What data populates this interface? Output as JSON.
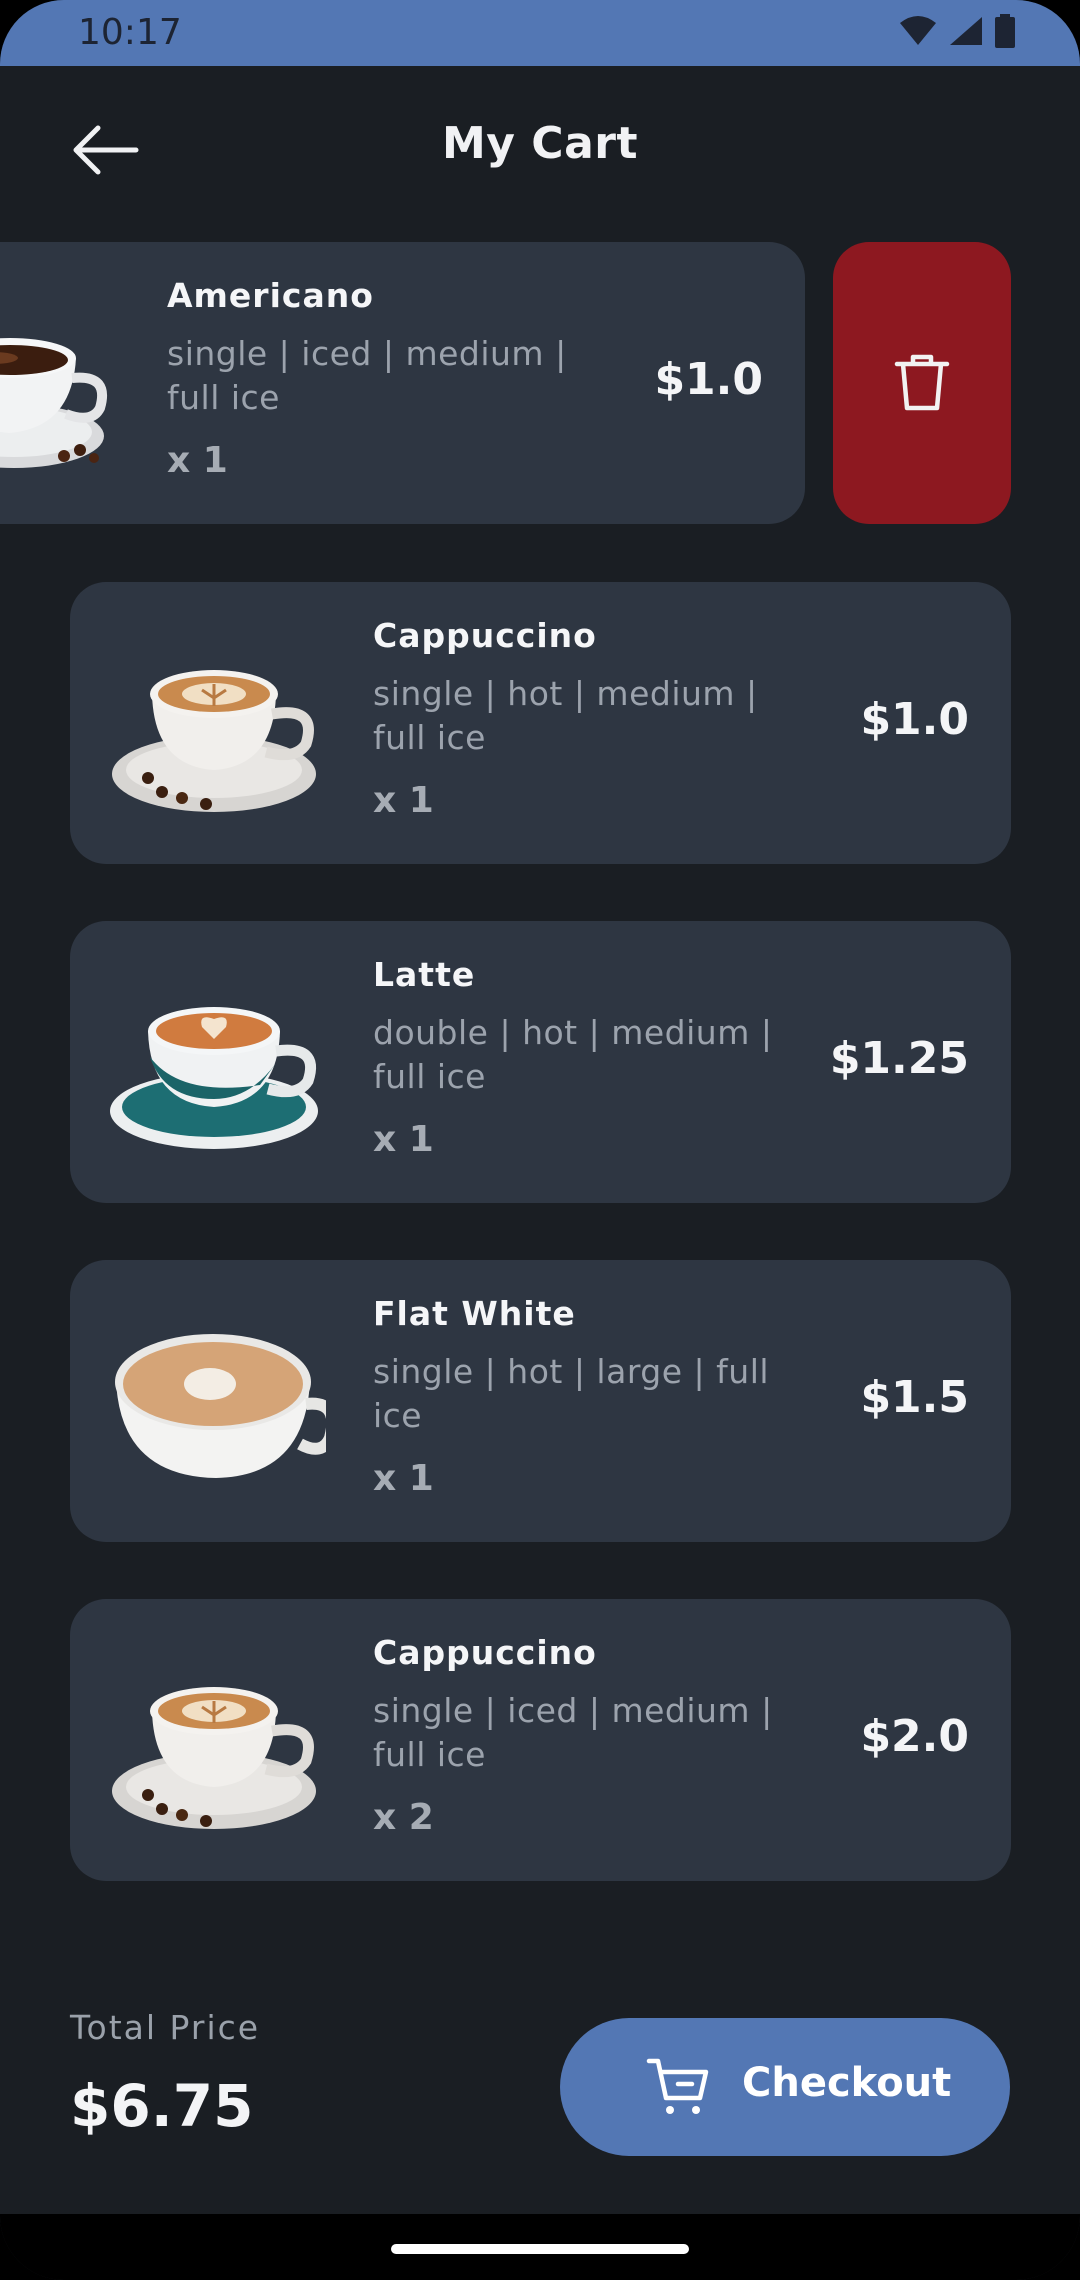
{
  "status_bar": {
    "time": "10:17"
  },
  "header": {
    "title": "My Cart"
  },
  "cart_items": [
    {
      "name": "Americano",
      "options": "single | iced | medium | full ice",
      "qty": "x 1",
      "price": "$1.0"
    },
    {
      "name": "Cappuccino",
      "options": "single | hot | medium | full ice",
      "qty": "x 1",
      "price": "$1.0"
    },
    {
      "name": "Latte",
      "options": "double | hot | medium | full ice",
      "qty": "x 1",
      "price": "$1.25"
    },
    {
      "name": "Flat White",
      "options": "single | hot | large | full ice",
      "qty": "x 1",
      "price": "$1.5"
    },
    {
      "name": "Cappuccino",
      "options": "single | iced | medium | full ice",
      "qty": "x 2",
      "price": "$2.0"
    }
  ],
  "footer": {
    "total_label": "Total Price",
    "total_value": "$6.75",
    "checkout_label": "Checkout"
  },
  "colors": {
    "background": "#1a1e23",
    "card": "#2e3642",
    "accent": "#5377b4",
    "delete": "#8d1820"
  }
}
